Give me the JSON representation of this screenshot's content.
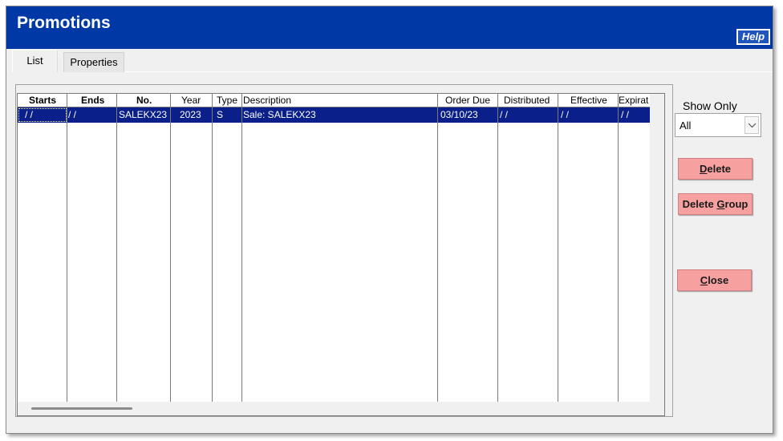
{
  "window": {
    "title": "Promotions",
    "help_label": "Help"
  },
  "tabs": [
    {
      "label": "List",
      "active": true
    },
    {
      "label": "Properties",
      "active": false
    }
  ],
  "grid": {
    "columns": [
      "Starts",
      "Ends",
      "No.",
      "Year",
      "Type",
      "Description",
      "Order Due",
      "Distributed",
      "Effective",
      "Expirat"
    ],
    "rows": [
      {
        "starts": " /  /",
        "ends": " /  /",
        "no": "SALEKX23",
        "year": "2023",
        "type": "S",
        "description": "Sale: SALEKX23",
        "order_due": "03/10/23",
        "distributed": " /  /",
        "effective": " /  /",
        "expiration": " /  /",
        "selected": true
      }
    ]
  },
  "filter": {
    "label": "Show Only",
    "value": "All",
    "arrow_icon": "chevron-down-icon"
  },
  "buttons": {
    "delete": {
      "prefix": "",
      "mnemonic": "D",
      "suffix": "elete"
    },
    "delete_group": {
      "prefix": "Delete ",
      "mnemonic": "G",
      "suffix": "roup"
    },
    "close": {
      "prefix": "",
      "mnemonic": "C",
      "suffix": "lose"
    }
  },
  "colors": {
    "titlebar": "#0039a6",
    "selected_row": "#0a1f8a",
    "button_bg": "#f7a0a0"
  }
}
